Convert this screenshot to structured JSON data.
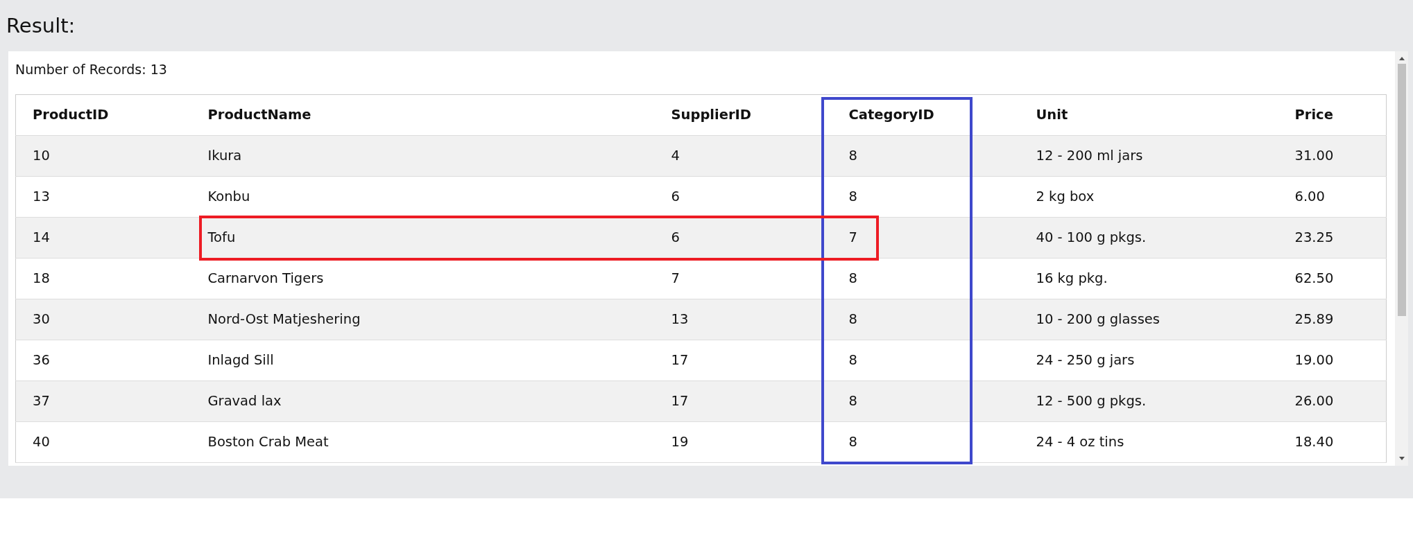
{
  "heading": "Result:",
  "record_count": "Number of Records: 13",
  "table": {
    "columns": [
      {
        "label": "ProductID",
        "outlined": false
      },
      {
        "label": "ProductName",
        "outlined": false
      },
      {
        "label": "SupplierID",
        "outlined": false
      },
      {
        "label": "CategoryID",
        "outlined": true
      },
      {
        "label": "Unit",
        "outlined": false
      },
      {
        "label": "Price",
        "outlined": false
      }
    ],
    "rows": [
      {
        "cells": [
          "10",
          "Ikura",
          "4",
          "8",
          "12 - 200 ml jars",
          "31.00"
        ],
        "outlined": false
      },
      {
        "cells": [
          "13",
          "Konbu",
          "6",
          "8",
          "2 kg box",
          "6.00"
        ],
        "outlined": false
      },
      {
        "cells": [
          "14",
          "Tofu",
          "6",
          "7",
          "40 - 100 g pkgs.",
          "23.25"
        ],
        "outlined": true
      },
      {
        "cells": [
          "18",
          "Carnarvon Tigers",
          "7",
          "8",
          "16 kg pkg.",
          "62.50"
        ],
        "outlined": false
      },
      {
        "cells": [
          "30",
          "Nord-Ost Matjeshering",
          "13",
          "8",
          "10 - 200 g glasses",
          "25.89"
        ],
        "outlined": false
      },
      {
        "cells": [
          "36",
          "Inlagd Sill",
          "17",
          "8",
          "24 - 250 g jars",
          "19.00"
        ],
        "outlined": false
      },
      {
        "cells": [
          "37",
          "Gravad lax",
          "17",
          "8",
          "12 - 500 g pkgs.",
          "26.00"
        ],
        "outlined": false
      },
      {
        "cells": [
          "40",
          "Boston Crab Meat",
          "19",
          "8",
          "24 - 4 oz tins",
          "18.40"
        ],
        "outlined": false
      }
    ]
  }
}
